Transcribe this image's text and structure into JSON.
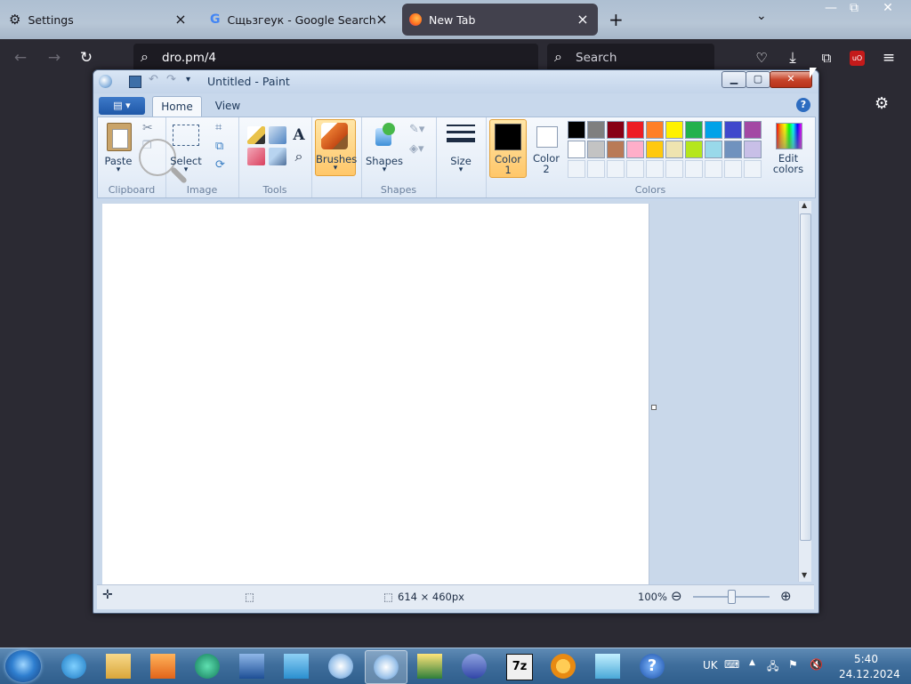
{
  "browser": {
    "tabs": [
      {
        "label": "Settings",
        "icon": "gear-icon"
      },
      {
        "label": "Сщьзгеук - Google Search",
        "icon": "google-icon"
      },
      {
        "label": "New Tab",
        "icon": "firefox-icon"
      }
    ],
    "url": "dro.pm/4",
    "search_placeholder": "Search",
    "window_controls": {
      "minimize": "—",
      "restore": "⧉",
      "close": "✕"
    },
    "extension_badge": "uO"
  },
  "paint": {
    "title": "Untitled - Paint",
    "quick_access": [
      "save-icon",
      "undo-icon",
      "redo-icon",
      "customize-icon"
    ],
    "ribbon_tabs": [
      {
        "label": "Home"
      },
      {
        "label": "View"
      }
    ],
    "groups": {
      "clipboard": {
        "label": "Clipboard",
        "paste": "Paste"
      },
      "image": {
        "label": "Image",
        "select": "Select"
      },
      "tools": {
        "label": "Tools"
      },
      "brushes": {
        "label": "Brushes"
      },
      "shapes": {
        "label": "Shapes",
        "group_label": "Shapes"
      },
      "size": {
        "label": "Size"
      },
      "colors": {
        "color1_label": "Color",
        "color1_num": "1",
        "color2_label": "Color",
        "color2_num": "2",
        "edit_label": "Edit",
        "edit_label2": "colors",
        "group_label": "Colors",
        "color1": "#000000",
        "color2": "#ffffff",
        "palette_row1": [
          "#000000",
          "#7f7f7f",
          "#880015",
          "#ed1c24",
          "#ff7f27",
          "#fff200",
          "#22b14c",
          "#00a2e8",
          "#3f48cc",
          "#a349a4"
        ],
        "palette_row2": [
          "#ffffff",
          "#c3c3c3",
          "#b97a57",
          "#ffaec9",
          "#ffc90e",
          "#efe4b0",
          "#b5e61d",
          "#99d9ea",
          "#7092be",
          "#c8bfe7"
        ]
      }
    },
    "status": {
      "canvas_size": "614 × 460px",
      "zoom": "100%"
    }
  },
  "taskbar": {
    "language": "UK",
    "time": "5:40",
    "date": "24.12.2024",
    "apps": [
      "ie-icon",
      "explorer-icon",
      "media-player-icon",
      "app-green-icon",
      "remote-desktop-icon",
      "telegram-icon",
      "paint-icon",
      "paint-active-icon",
      "app-yellow-icon",
      "infinity-icon",
      "7zip-icon",
      "search-app-icon",
      "notes-icon",
      "help-icon"
    ],
    "sevenzip_label": "7z"
  }
}
